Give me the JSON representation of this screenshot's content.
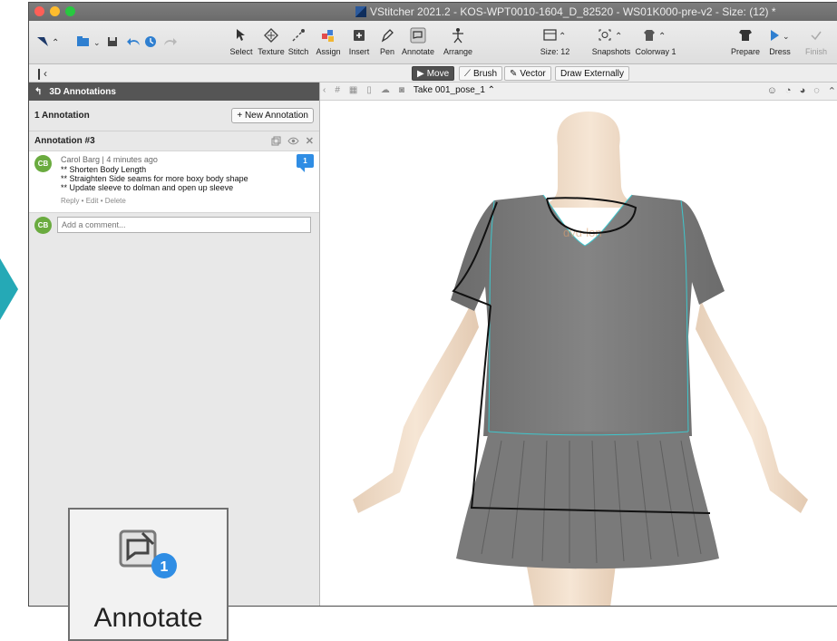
{
  "window": {
    "title": "VStitcher 2021.2 - KOS-WPT0010-1604_D_82520 - WS01K000-pre-v2 - Size: (12) *"
  },
  "toolbar": {
    "tools": [
      {
        "label": "Select",
        "icon": "select-cursor-icon"
      },
      {
        "label": "Texture",
        "icon": "texture-icon"
      },
      {
        "label": "Stitch",
        "icon": "stitch-icon"
      },
      {
        "label": "Assign",
        "icon": "assign-icon"
      },
      {
        "label": "Insert",
        "icon": "insert-icon"
      },
      {
        "label": "Pen",
        "icon": "pen-icon"
      },
      {
        "label": "Annotate",
        "icon": "annotate-icon"
      },
      {
        "label": "Arrange",
        "icon": "arrange-icon"
      },
      {
        "label": "Size: 12",
        "icon": "size-icon"
      },
      {
        "label": "Snapshots",
        "icon": "snapshots-icon"
      },
      {
        "label": "Colorway 1",
        "icon": "colorway-icon"
      },
      {
        "label": "Prepare",
        "icon": "prepare-icon"
      },
      {
        "label": "Dress",
        "icon": "dress-play-icon"
      },
      {
        "label": "Finish",
        "icon": "finish-check-icon"
      }
    ]
  },
  "strip": {
    "modes": [
      {
        "label": "Move",
        "icon": "play-icon",
        "active": true
      },
      {
        "label": "Brush",
        "icon": "brush-icon",
        "active": false
      },
      {
        "label": "Vector",
        "icon": "vector-pen-icon",
        "active": false
      }
    ],
    "draw_externally": "Draw Externally"
  },
  "panel": {
    "title": "3D Annotations",
    "count": "1 Annotation",
    "new_button": "+ New Annotation",
    "annotation": {
      "title": "Annotation #3",
      "author": "Carol Barg | 4 minutes ago",
      "initials": "CB",
      "lines": [
        "** Shorten Body Length",
        "** Straighten Side seams for more boxy body shape",
        "** Update sleeve to dolman and open up sleeve"
      ],
      "links": "Reply • Edit • Delete",
      "badge": "1"
    },
    "reply_placeholder": "Add a comment..."
  },
  "viewport": {
    "take": "Take 001_pose_1",
    "watermark": "ɑvɑ-lon"
  },
  "zoom": {
    "label": "Annotate",
    "badge": "1"
  },
  "colors": {
    "accent": "#25a9b6",
    "panel_header": "#555555",
    "badge": "#2f8de4",
    "avatar": "#6aab3f",
    "garment": "#777777",
    "skin": "#f0ddc8"
  }
}
